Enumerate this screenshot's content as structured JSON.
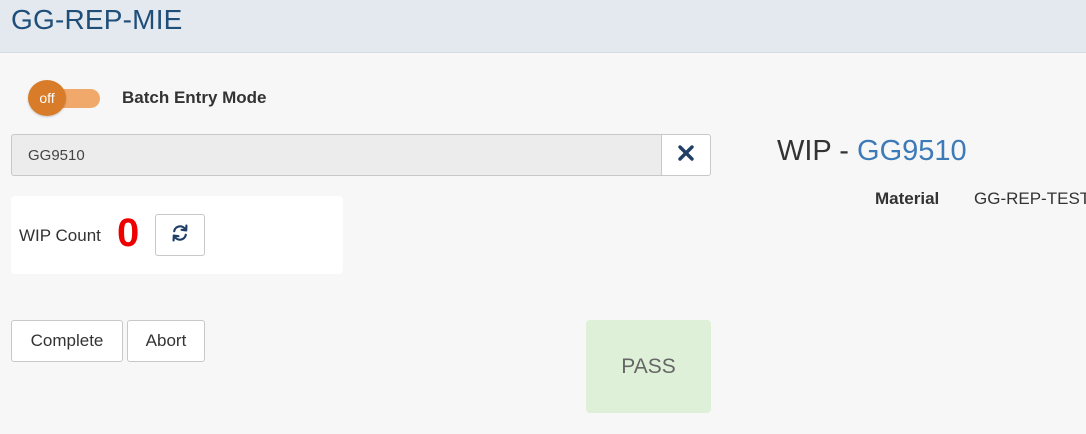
{
  "header": {
    "title": "GG-REP-MIE"
  },
  "batch_toggle": {
    "state_label": "off",
    "label": "Batch Entry Mode",
    "enabled": false
  },
  "search": {
    "value": "GG9510",
    "clear_icon": "close-icon"
  },
  "wip_count": {
    "label": "WIP Count",
    "value": "0",
    "refresh_icon": "refresh-icon"
  },
  "actions": {
    "complete_label": "Complete",
    "abort_label": "Abort"
  },
  "result": {
    "label": "PASS"
  },
  "details": {
    "prefix": "WIP - ",
    "wip_id": "GG9510",
    "material_label": "Material",
    "material_value": "GG-REP-TEST"
  },
  "colors": {
    "header_bg": "#e4e9ef",
    "title": "#1f4e79",
    "toggle_knob": "#d97c2a",
    "toggle_track": "#f0a96a",
    "wip_count_value": "#ee0000",
    "wip_id_link": "#3d7ab8",
    "pass_bg": "#dff0d8"
  }
}
